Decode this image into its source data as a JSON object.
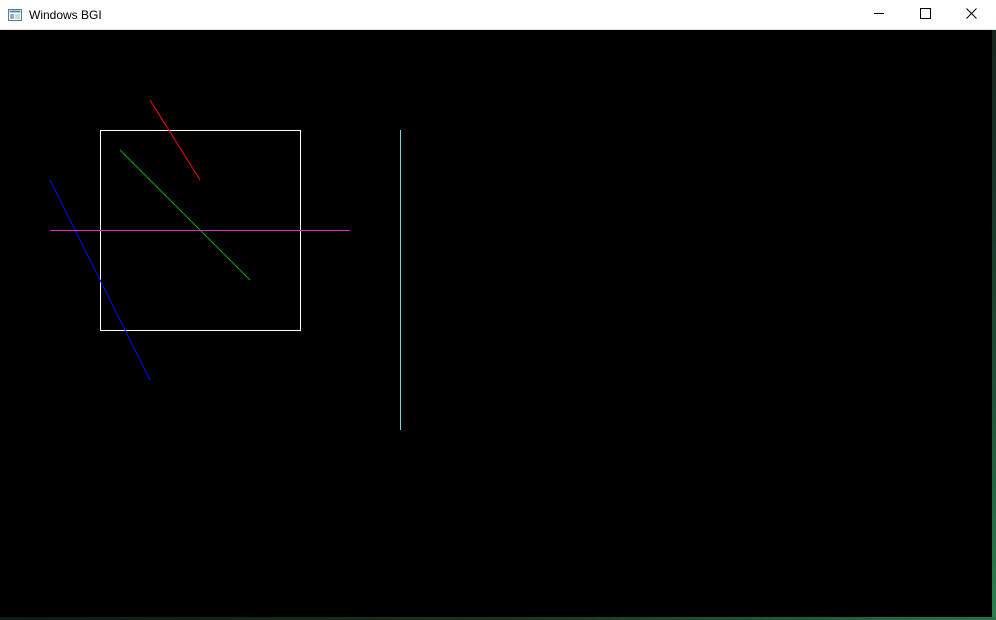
{
  "window": {
    "title": "Windows BGI",
    "icon": "app-window-icon",
    "controls": {
      "minimize_icon": "minimize-icon",
      "maximize_icon": "maximize-icon",
      "close_icon": "close-icon"
    }
  },
  "canvas": {
    "background": "#000000",
    "shapes": [
      {
        "name": "white-rectangle",
        "type": "rectangle",
        "color": "#ffffff"
      },
      {
        "name": "red-line",
        "type": "line",
        "color": "#ff0000"
      },
      {
        "name": "green-line",
        "type": "line",
        "color": "#00aa00"
      },
      {
        "name": "blue-line",
        "type": "line",
        "color": "#0000ff"
      },
      {
        "name": "magenta-line",
        "type": "line",
        "color": "#cc33cc"
      },
      {
        "name": "cyan-line",
        "type": "line",
        "color": "#66dddd"
      }
    ]
  }
}
